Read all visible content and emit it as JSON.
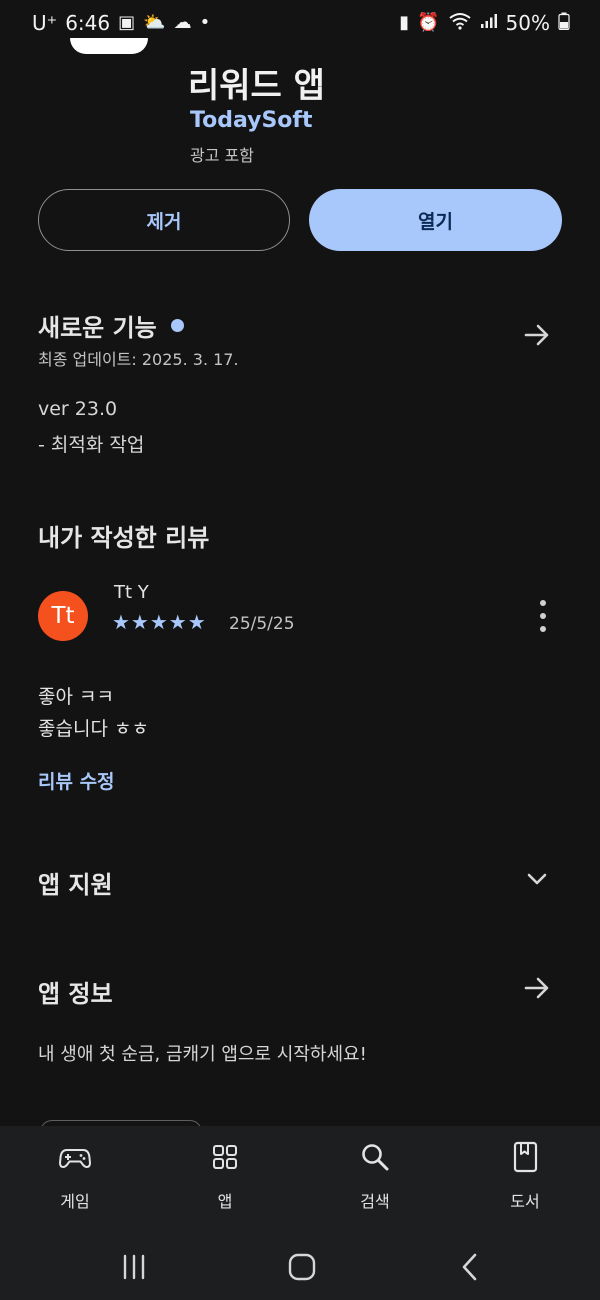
{
  "status_bar": {
    "carrier": "U⁺",
    "time": "6:46",
    "battery": "50%"
  },
  "app": {
    "title": "리워드 앱",
    "developer": "TodaySoft",
    "ads_label": "광고 포함"
  },
  "actions": {
    "remove_label": "제거",
    "open_label": "열기"
  },
  "whats_new": {
    "title": "새로운 기능",
    "updated": "최종 업데이트: 2025. 3. 17.",
    "version": "ver 23.0",
    "notes": "- 최적화 작업"
  },
  "my_review": {
    "title": "내가 작성한 리뷰",
    "avatar_initials": "Tt",
    "reviewer": "Tt Y",
    "stars": "★★★★★",
    "rating": 5,
    "date": "25/5/25",
    "text_line1": "좋아 ㅋㅋ",
    "text_line2": "좋습니다 ㅎㅎ",
    "edit_label": "리뷰 수정"
  },
  "support": {
    "title": "앱 지원"
  },
  "about": {
    "title": "앱 정보",
    "description": "내 생애 첫 순금, 금캐기 앱으로 시작하세요!"
  },
  "bottom_nav": [
    {
      "label": "게임",
      "icon": "gamepad-icon"
    },
    {
      "label": "앱",
      "icon": "apps-grid-icon"
    },
    {
      "label": "검색",
      "icon": "search-icon"
    },
    {
      "label": "도서",
      "icon": "book-icon"
    }
  ],
  "colors": {
    "background": "#131313",
    "accent": "#a8c7fa",
    "avatar": "#f4511e"
  }
}
